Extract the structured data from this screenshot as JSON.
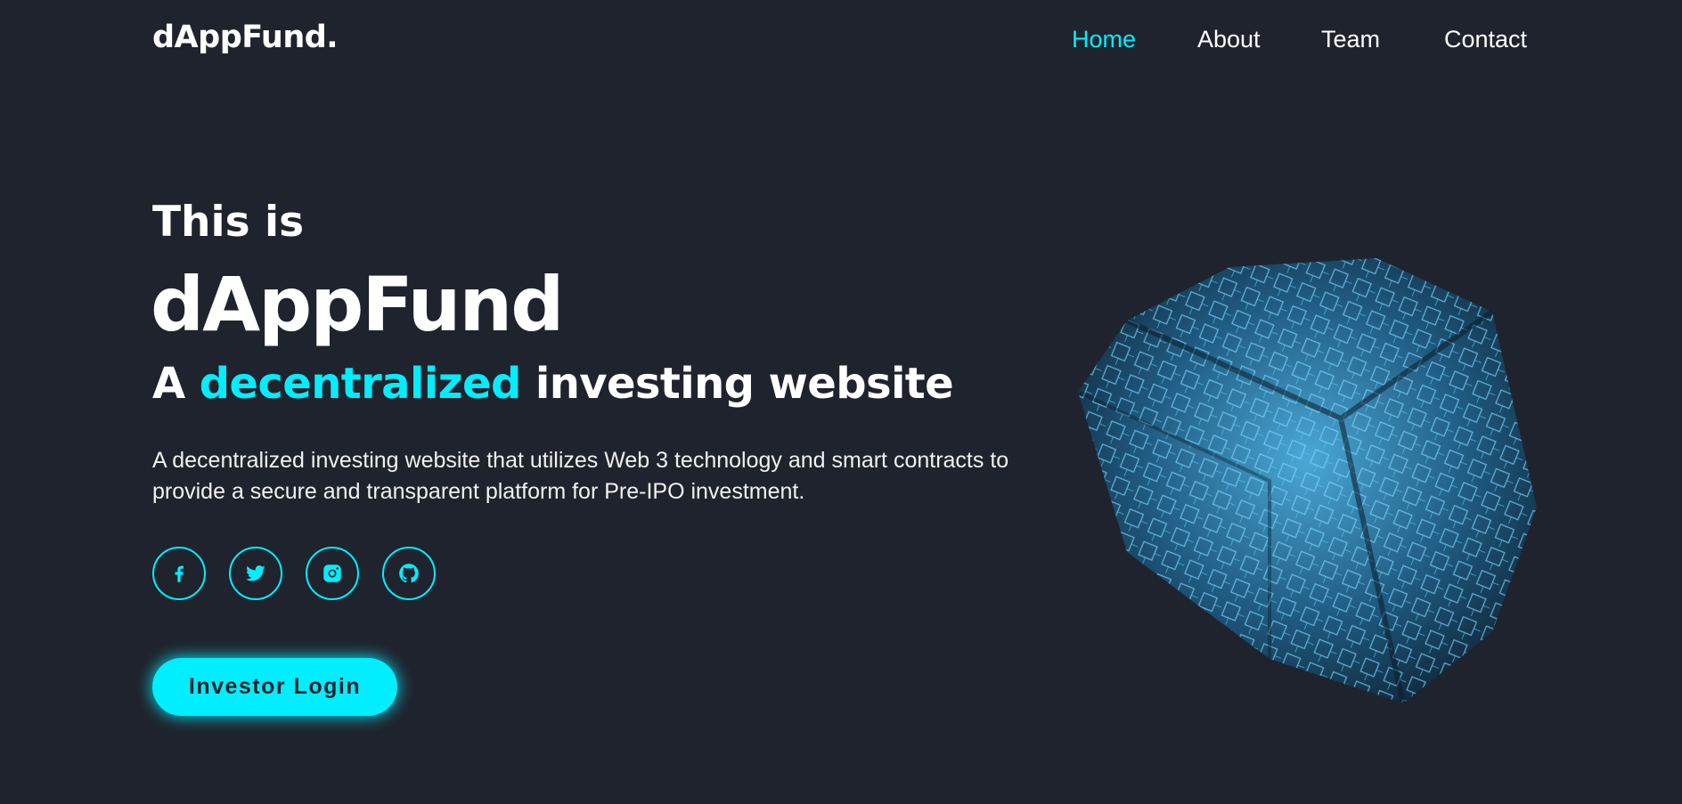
{
  "header": {
    "logo": "dAppFund.",
    "nav": [
      {
        "label": "Home",
        "active": true
      },
      {
        "label": "About",
        "active": false
      },
      {
        "label": "Team",
        "active": false
      },
      {
        "label": "Contact",
        "active": false
      }
    ]
  },
  "hero": {
    "intro": "This is",
    "brand": "dAppFund",
    "tagline_prefix": "A ",
    "tagline_accent": "decentralized",
    "tagline_suffix": " investing website",
    "description": "A decentralized investing website that utilizes Web 3 technology and smart contracts to provide a secure and transparent platform for Pre-IPO investment.",
    "socials": [
      {
        "icon": "facebook-icon"
      },
      {
        "icon": "twitter-icon"
      },
      {
        "icon": "instagram-icon"
      },
      {
        "icon": "github-icon"
      }
    ],
    "cta_label": "Investor Login",
    "image": "blockchain-cube-illustration"
  },
  "colors": {
    "background": "#1f232d",
    "accent": "#00eeff",
    "text": "#ffffff"
  }
}
